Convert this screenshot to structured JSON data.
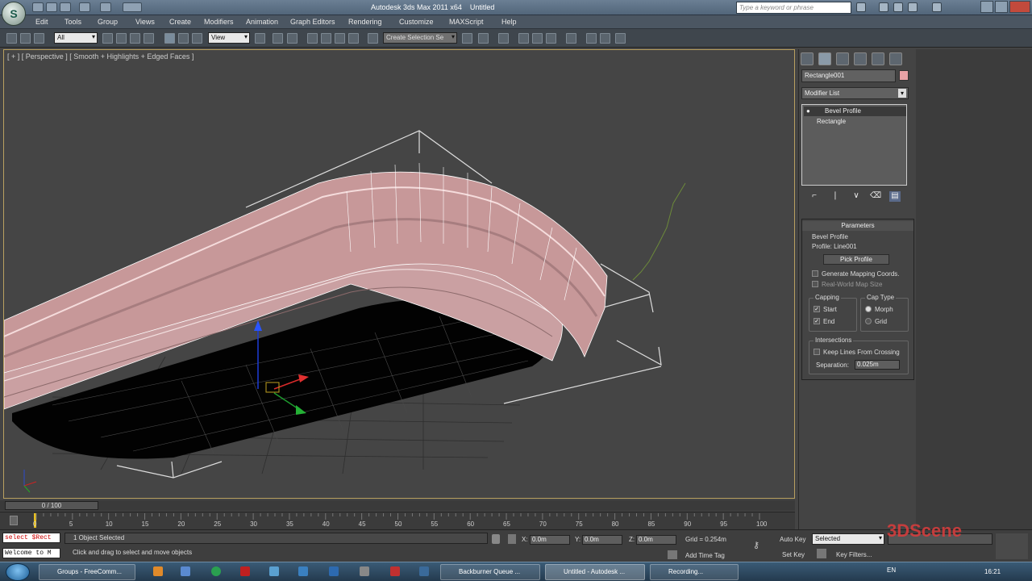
{
  "window": {
    "title": "Autodesk 3ds Max 2011 x64",
    "doc_title": "Untitled",
    "search_placeholder": "Type a keyword or phrase"
  },
  "menu": [
    "Edit",
    "Tools",
    "Group",
    "Views",
    "Create",
    "Modifiers",
    "Animation",
    "Graph Editors",
    "Rendering",
    "Customize",
    "MAXScript",
    "Help"
  ],
  "toolbar": {
    "selection_filter": "All",
    "ref_coord": "View",
    "named_selection": "Create Selection Se"
  },
  "viewport": {
    "label": "[ + ] [ Perspective ] [ Smooth + Highlights + Edged Faces ]"
  },
  "command_panel": {
    "object_name": "Rectangle001",
    "object_color": "#e8a2a6",
    "modifier_list": "Modifier List",
    "stack": [
      "Bevel Profile",
      "Rectangle"
    ],
    "params_title": "Parameters",
    "bevel_profile_group": "Bevel Profile",
    "profile_label": "Profile: Line001",
    "pick_profile": "Pick Profile",
    "gen_mapping": "Generate Mapping Coords.",
    "real_world": "Real-World Map Size",
    "capping_title": "Capping",
    "cap_start": "Start",
    "cap_end": "End",
    "captype_title": "Cap Type",
    "morph": "Morph",
    "grid": "Grid",
    "intersections_title": "Intersections",
    "keep_lines": "Keep Lines From Crossing",
    "separation_label": "Separation:",
    "separation_value": "0.025m"
  },
  "timeline": {
    "slider": "0 / 100",
    "ticks": [
      "0",
      "5",
      "10",
      "15",
      "20",
      "25",
      "30",
      "35",
      "40",
      "45",
      "50",
      "55",
      "60",
      "65",
      "70",
      "75",
      "80",
      "85",
      "90",
      "95",
      "100"
    ]
  },
  "status": {
    "maxscript_line1": "select $Rect",
    "maxscript_line2": "Welcome to M",
    "selected": "1 Object Selected",
    "prompt": "Click and drag to select and move objects",
    "x_label": "X:",
    "x": "0.0m",
    "y_label": "Y:",
    "y": "0.0m",
    "z_label": "Z:",
    "z": "0.0m",
    "grid": "Grid = 0.254m",
    "add_time_tag": "Add Time Tag",
    "auto_key": "Auto Key",
    "set_key": "Set Key",
    "selected_dd": "Selected",
    "key_filters": "Key Filters..."
  },
  "taskbar": {
    "tasks": [
      "Groups - FreeComm...",
      "Backburner Queue ...",
      "Untitled - Autodesk ...",
      "Recording..."
    ],
    "lang": "EN",
    "clock": "16:21"
  },
  "watermark": "3DScene"
}
